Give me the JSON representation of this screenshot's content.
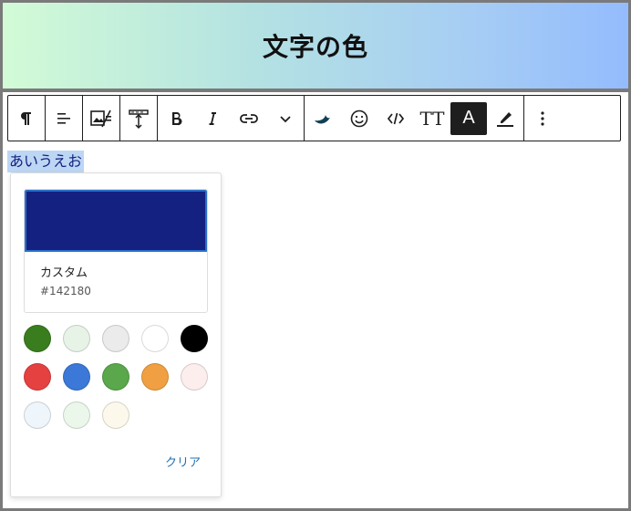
{
  "header": {
    "title": "文字の色"
  },
  "toolbar": {
    "groups": [
      [
        "pilcrow-icon"
      ],
      [
        "align-icon"
      ],
      [
        "media-text-icon"
      ],
      [
        "height-icon"
      ],
      [
        "bold-icon",
        "italic-icon",
        "link-icon",
        "chevron-down-icon"
      ],
      [
        "custom-plugin-icon",
        "emoji-icon",
        "code-icon",
        "text-size-icon",
        "text-color-icon",
        "highlighter-icon"
      ],
      [
        "more-options-icon"
      ]
    ],
    "text_size_label": "TT",
    "text_color_label": "A"
  },
  "editor": {
    "selected_text": "あいうえお"
  },
  "color_picker": {
    "current_color": "#142180",
    "name": "カスタム",
    "hex_label": "#142180",
    "palette": [
      [
        "#3a7d1e",
        "#e8f3e8",
        "#ebebeb",
        "#ffffff",
        "#000000"
      ],
      [
        "#e54141",
        "#3b78d8",
        "#5ba74b",
        "#f0a042",
        "#fdeeee"
      ],
      [
        "#eef5fb",
        "#ebf7eb",
        "#fdf8ec"
      ]
    ],
    "clear_label": "クリア"
  }
}
